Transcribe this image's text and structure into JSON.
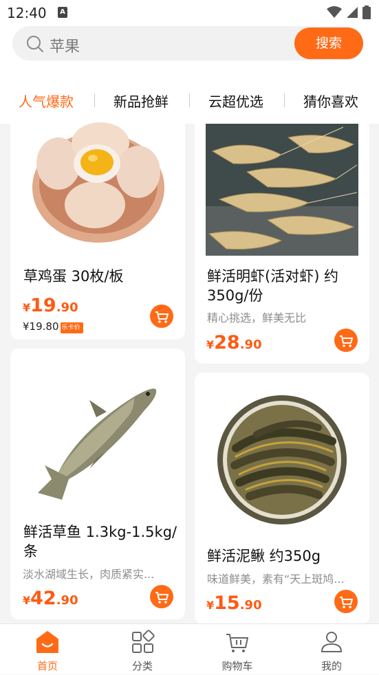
{
  "statusbar": {
    "time": "12:40",
    "sim_label": "A"
  },
  "search": {
    "placeholder": "苹果",
    "button_label": "搜索"
  },
  "tabs": [
    {
      "label": "人气爆款",
      "active": true
    },
    {
      "label": "新品抢鲜",
      "active": false
    },
    {
      "label": "云超优选",
      "active": false
    },
    {
      "label": "猜你喜欢",
      "active": false
    }
  ],
  "products": [
    {
      "title": "草鸡蛋 30枚/板",
      "subtitle": "",
      "currency": "¥",
      "price_int": "19",
      "price_dec": ".90",
      "member_price": "¥19.80",
      "member_badge": "乐卡价"
    },
    {
      "title": "鲜活明虾(活对虾) 约350g/份",
      "subtitle": "精心挑选，鲜美无比",
      "currency": "¥",
      "price_int": "28",
      "price_dec": ".90"
    },
    {
      "title": "鲜活草鱼 1.3kg-1.5kg/条",
      "subtitle": "淡水湖域生长，肉质紧实...",
      "currency": "¥",
      "price_int": "42",
      "price_dec": ".90"
    },
    {
      "title": "鲜活泥鳅 约350g",
      "subtitle": "味道鲜美，素有“天上斑鸠...",
      "currency": "¥",
      "price_int": "15",
      "price_dec": ".90"
    }
  ],
  "bottom_nav": [
    {
      "label": "首页",
      "icon": "home-icon",
      "active": true
    },
    {
      "label": "分类",
      "icon": "category-icon",
      "active": false
    },
    {
      "label": "购物车",
      "icon": "cart-icon",
      "active": false
    },
    {
      "label": "我的",
      "icon": "profile-icon",
      "active": false
    }
  ],
  "colors": {
    "accent": "#ff6a16",
    "price": "#ff5a12",
    "background": "#f4f4f4"
  }
}
